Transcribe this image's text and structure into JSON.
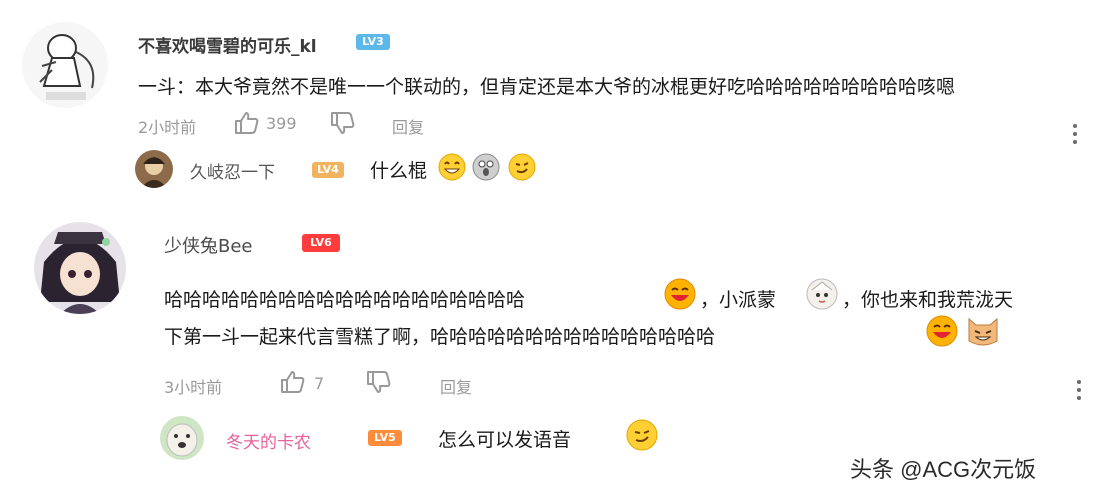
{
  "comments": [
    {
      "username": "不喜欢喝雪碧的可乐_kl",
      "level": "LV3",
      "text": "一斗：本大爷竟然不是唯一一个联动的，但肯定还是本大爷的冰棍更好吃哈哈哈哈哈哈哈哈哈咳嗯",
      "time": "2小时前",
      "likes": "399",
      "reply_label": "回复",
      "replies": [
        {
          "username": "久岐忍一下",
          "level": "LV4",
          "text": "什么棍"
        }
      ]
    },
    {
      "username": "少侠兔Bee",
      "level": "LV6",
      "line1_a": "哈哈哈哈哈哈哈哈哈哈哈哈哈哈哈哈哈哈哈",
      "line1_b": "，小派蒙",
      "line1_c": "，你也来和我荒泷天",
      "line2": "下第一斗一起来代言雪糕了啊，哈哈哈哈哈哈哈哈哈哈哈哈哈哈哈",
      "time": "3小时前",
      "likes": "7",
      "reply_label": "回复",
      "replies": [
        {
          "username": "冬天的卡农",
          "level": "LV5",
          "text": "怎么可以发语音"
        }
      ]
    }
  ],
  "watermark": "头条 @ACG次元饭",
  "colors": {
    "lv3": "#5bb8e8",
    "lv4": "#f2b35e",
    "lv5": "#ff8c3a",
    "lv6": "#ff3b3b",
    "pink_name": "#e8619a"
  }
}
